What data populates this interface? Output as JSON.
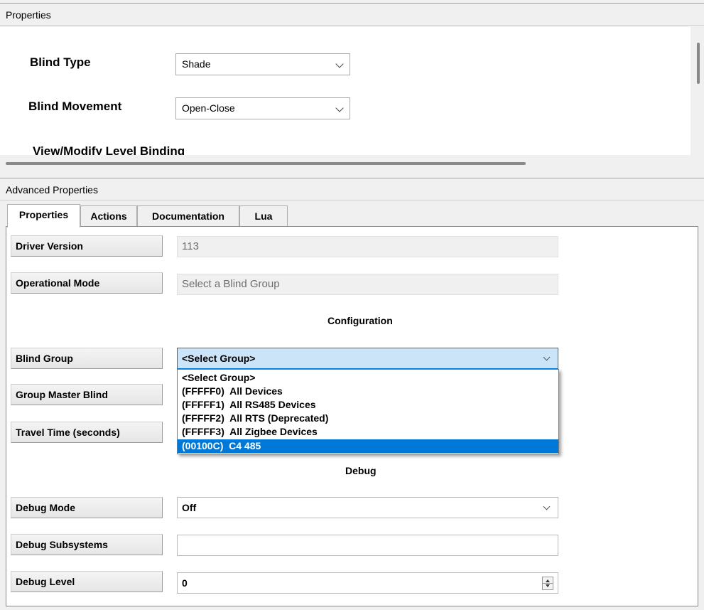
{
  "properties_panel": {
    "title": "Properties",
    "blind_type": {
      "label": "Blind Type",
      "value": "Shade"
    },
    "blind_movement": {
      "label": "Blind Movement",
      "value": "Open-Close"
    },
    "level_binding_label": "View/Modify Level Binding"
  },
  "advanced_panel": {
    "title": "Advanced Properties",
    "tabs": [
      {
        "label": "Properties",
        "active": true
      },
      {
        "label": "Actions",
        "active": false
      },
      {
        "label": "Documentation",
        "active": false
      },
      {
        "label": "Lua",
        "active": false
      }
    ],
    "driver_version": {
      "label": "Driver Version",
      "value": "113"
    },
    "operational_mode": {
      "label": "Operational Mode",
      "value": "Select a Blind Group"
    },
    "configuration_title": "Configuration",
    "blind_group": {
      "label": "Blind Group",
      "value": "<Select Group>",
      "options": [
        "<Select Group>",
        "(FFFFF0)  All Devices",
        "(FFFFF1)  All RS485 Devices",
        "(FFFFF2)  All RTS (Deprecated)",
        "(FFFFF3)  All Zigbee Devices",
        "(00100C)  C4 485"
      ],
      "highlighted_option": "(00100C)  C4 485"
    },
    "group_master_blind": {
      "label": "Group Master Blind"
    },
    "travel_time": {
      "label": "Travel Time (seconds)"
    },
    "debug_title": "Debug",
    "debug_mode": {
      "label": "Debug Mode",
      "value": "Off"
    },
    "debug_subsystems": {
      "label": "Debug Subsystems",
      "value": ""
    },
    "debug_level": {
      "label": "Debug Level",
      "value": "0"
    }
  }
}
